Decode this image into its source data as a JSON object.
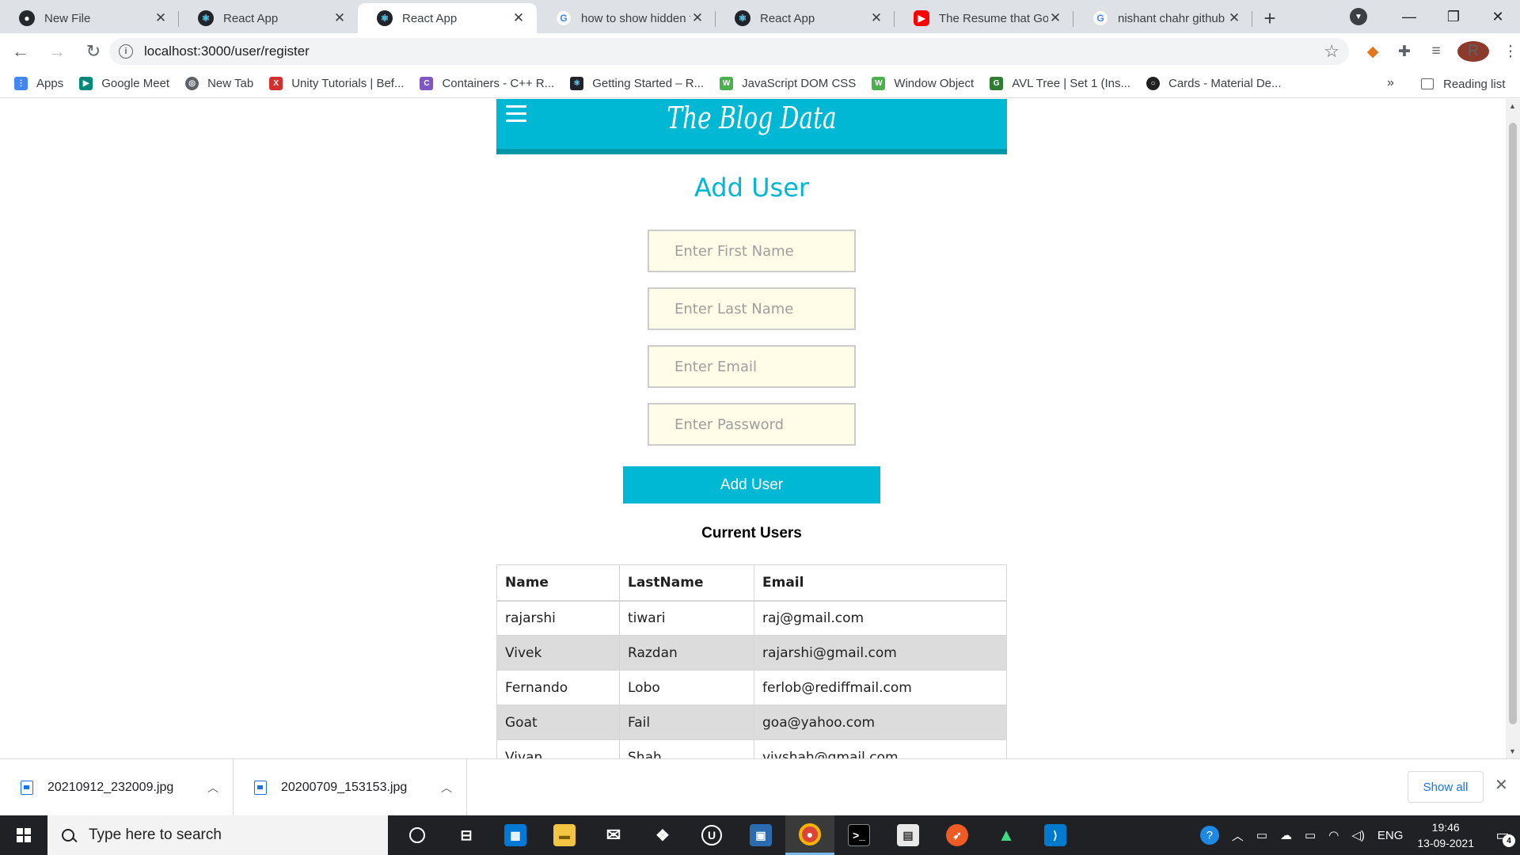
{
  "browser": {
    "tabs": [
      {
        "title": "New File",
        "icon": "github-icon"
      },
      {
        "title": "React App",
        "icon": "react-icon"
      },
      {
        "title": "React App",
        "icon": "react-icon",
        "active": true
      },
      {
        "title": "how to show hidden f",
        "icon": "google-icon"
      },
      {
        "title": "React App",
        "icon": "react-icon"
      },
      {
        "title": "The Resume that Got",
        "icon": "youtube-icon"
      },
      {
        "title": "nishant chahr github",
        "icon": "google-icon"
      }
    ],
    "url": "localhost:3000/user/register",
    "avatar_letter": "R",
    "bookmarks": [
      {
        "label": "Apps",
        "icon": "apps-grid-icon",
        "color": "#4285f4"
      },
      {
        "label": "Google Meet",
        "icon": "google-meet-icon",
        "color": "#00897b"
      },
      {
        "label": "New Tab",
        "icon": "globe-icon",
        "color": "#5f6368"
      },
      {
        "label": "Unity Tutorials | Bef...",
        "icon": "edx-icon",
        "color": "#d32f2f"
      },
      {
        "label": "Containers - C++ R...",
        "icon": "cpp-reference-icon",
        "color": "#7e57c2"
      },
      {
        "label": "Getting Started – R...",
        "icon": "react-icon",
        "color": "#20232a"
      },
      {
        "label": "JavaScript DOM CSS",
        "icon": "w3schools-icon",
        "color": "#4caf50"
      },
      {
        "label": "Window Object",
        "icon": "w3schools-icon",
        "color": "#4caf50"
      },
      {
        "label": "AVL Tree | Set 1 (Ins...",
        "icon": "geeksforgeeks-icon",
        "color": "#2e7d32"
      },
      {
        "label": "Cards - Material De...",
        "icon": "material-icon",
        "color": "#212121"
      }
    ],
    "bookmarks_more": "»",
    "reading_list": "Reading list"
  },
  "page": {
    "brand_title": "The Blog Data",
    "heading": "Add User",
    "form": {
      "first_name_placeholder": "Enter First Name",
      "last_name_placeholder": "Enter Last Name",
      "email_placeholder": "Enter Email",
      "password_placeholder": "Enter Password",
      "submit_label": "Add User"
    },
    "users_heading": "Current Users",
    "table": {
      "headers": [
        "Name",
        "LastName",
        "Email"
      ],
      "rows": [
        [
          "rajarshi",
          "tiwari",
          "raj@gmail.com"
        ],
        [
          "Vivek",
          "Razdan",
          "rajarshi@gmail.com"
        ],
        [
          "Fernando",
          "Lobo",
          "ferlob@rediffmail.com"
        ],
        [
          "Goat",
          "Fail",
          "goa@yahoo.com"
        ],
        [
          "Vivan",
          "Shah",
          "vivshah@gmail.com"
        ]
      ]
    },
    "accent_color": "#00b8d4"
  },
  "downloads": {
    "items": [
      {
        "name": "20210912_232009.jpg"
      },
      {
        "name": "20200709_153153.jpg"
      }
    ],
    "show_all": "Show all"
  },
  "taskbar": {
    "search_placeholder": "Type here to search",
    "language": "ENG",
    "time": "19:46",
    "date": "13-09-2021",
    "notification_count": "4"
  }
}
